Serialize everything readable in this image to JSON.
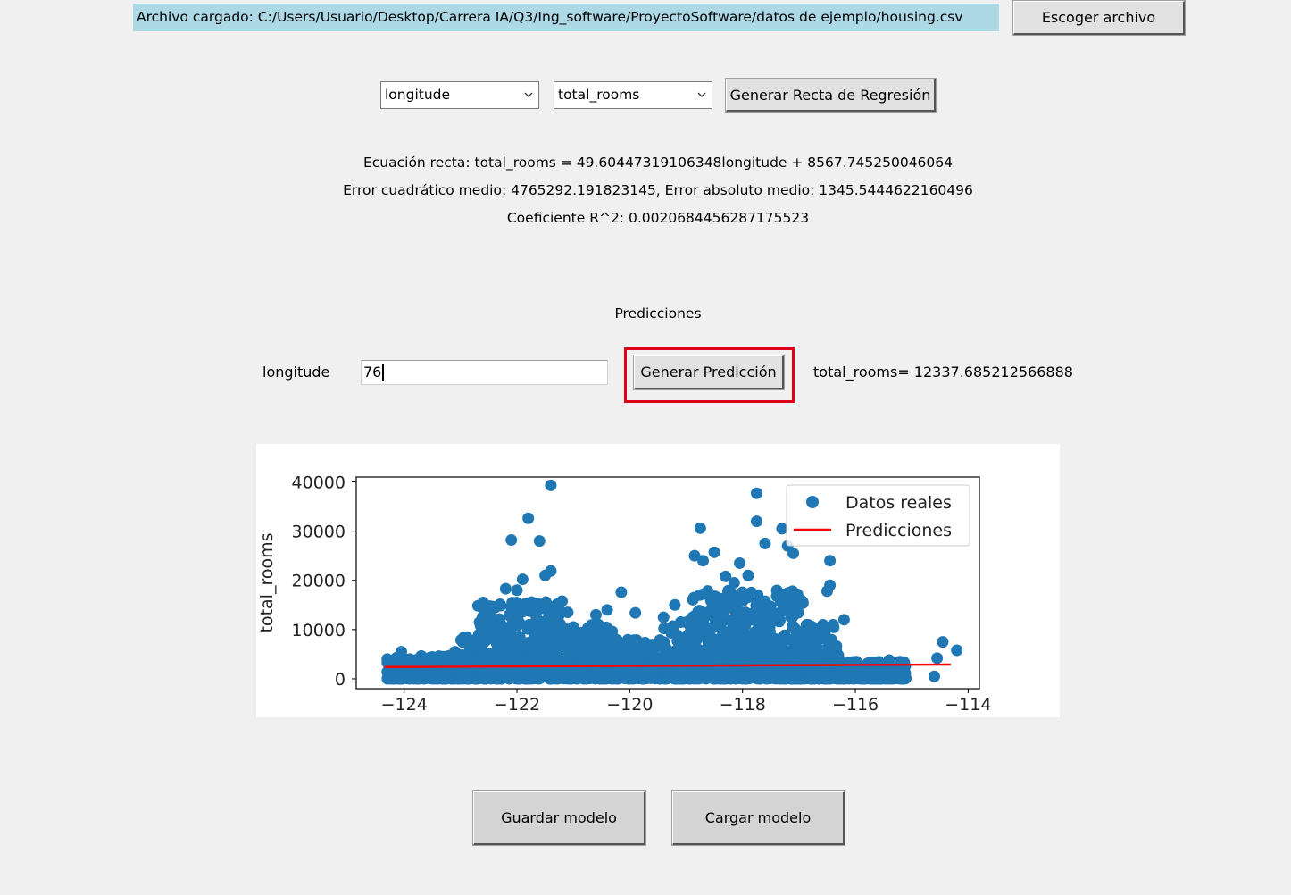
{
  "file": {
    "loaded_label": "Archivo cargado: C:/Users/Usuario/Desktop/Carrera IA/Q3/Ing_software/ProyectoSoftware/datos de ejemplo/housing.csv",
    "choose_button": "Escoger archivo"
  },
  "selectors": {
    "x_column": "longitude",
    "y_column": "total_rooms",
    "generate_button": "Generar Recta de Regresión"
  },
  "results": {
    "equation": "Ecuación recta: total_rooms = 49.60447319106348longitude + 8567.745250046064",
    "errors": "Error cuadrático medio: 4765292.191823145, Error absoluto medio: 1345.5444622160496",
    "r2": "Coeficiente R^2: 0.0020684456287175523"
  },
  "prediction": {
    "section_title": "Predicciones",
    "input_label": "longitude",
    "input_value": "76",
    "button": "Generar Predicción",
    "output": "total_rooms= 12337.685212566888"
  },
  "chart_data": {
    "type": "scatter",
    "title": "",
    "xlabel": "",
    "ylabel": "total_rooms",
    "xlim": [
      -124.85,
      -113.8
    ],
    "ylim": [
      -2000,
      41000
    ],
    "xticks": [
      -124,
      -122,
      -120,
      -118,
      -116,
      -114
    ],
    "yticks": [
      0,
      10000,
      20000,
      30000,
      40000
    ],
    "legend_position": "top-right",
    "series": [
      {
        "name": "Datos reales",
        "kind": "scatter",
        "color": "#1f77b4",
        "points": [
          [
            -121.4,
            39300
          ],
          [
            -121.8,
            32600
          ],
          [
            -122.1,
            28200
          ],
          [
            -121.6,
            28000
          ],
          [
            -121.4,
            21900
          ],
          [
            -121.5,
            21000
          ],
          [
            -121.9,
            20200
          ],
          [
            -122.2,
            18300
          ],
          [
            -122.0,
            18000
          ],
          [
            -122.6,
            15500
          ],
          [
            -120.15,
            17600
          ],
          [
            -120.4,
            14000
          ],
          [
            -119.9,
            13400
          ],
          [
            -118.75,
            30600
          ],
          [
            -118.5,
            25700
          ],
          [
            -118.85,
            25000
          ],
          [
            -118.7,
            24000
          ],
          [
            -117.75,
            37700
          ],
          [
            -117.75,
            32000
          ],
          [
            -117.6,
            27500
          ],
          [
            -117.3,
            30500
          ],
          [
            -117.2,
            27000
          ],
          [
            -117.1,
            25500
          ],
          [
            -118.05,
            23500
          ],
          [
            -117.9,
            21000
          ],
          [
            -116.45,
            24000
          ],
          [
            -116.45,
            19000
          ],
          [
            -116.5,
            17800
          ],
          [
            -118.3,
            20800
          ],
          [
            -118.15,
            19500
          ],
          [
            -119.2,
            15000
          ],
          [
            -121.1,
            13500
          ],
          [
            -120.6,
            13000
          ],
          [
            -119.4,
            12500
          ],
          [
            -116.2,
            12000
          ],
          [
            -123.1,
            5500
          ],
          [
            -124.05,
            5500
          ],
          [
            -114.45,
            7500
          ],
          [
            -114.2,
            5800
          ],
          [
            -114.55,
            4200
          ],
          [
            -114.6,
            500
          ],
          [
            -115.4,
            3800
          ],
          [
            -124.2,
            2500
          ],
          [
            -124.3,
            1400
          ]
        ],
        "dense_band": [
          {
            "x": [
              -124.3,
              -123.0
            ],
            "ymax": 4800
          },
          {
            "x": [
              -123.0,
              -122.7
            ],
            "ymax": 9000
          },
          {
            "x": [
              -122.7,
              -121.2
            ],
            "ymax": 16000
          },
          {
            "x": [
              -121.2,
              -120.3
            ],
            "ymax": 11500
          },
          {
            "x": [
              -120.3,
              -119.4
            ],
            "ymax": 8000
          },
          {
            "x": [
              -119.4,
              -118.9
            ],
            "ymax": 12000
          },
          {
            "x": [
              -118.9,
              -116.9
            ],
            "ymax": 18000
          },
          {
            "x": [
              -116.9,
              -116.3
            ],
            "ymax": 11000
          },
          {
            "x": [
              -116.3,
              -115.1
            ],
            "ymax": 3500
          }
        ]
      },
      {
        "name": "Predicciones",
        "kind": "line",
        "color": "#ff0000",
        "x": [
          -124.35,
          -114.31
        ],
        "y": [
          2400,
          2900
        ]
      }
    ]
  }
}
